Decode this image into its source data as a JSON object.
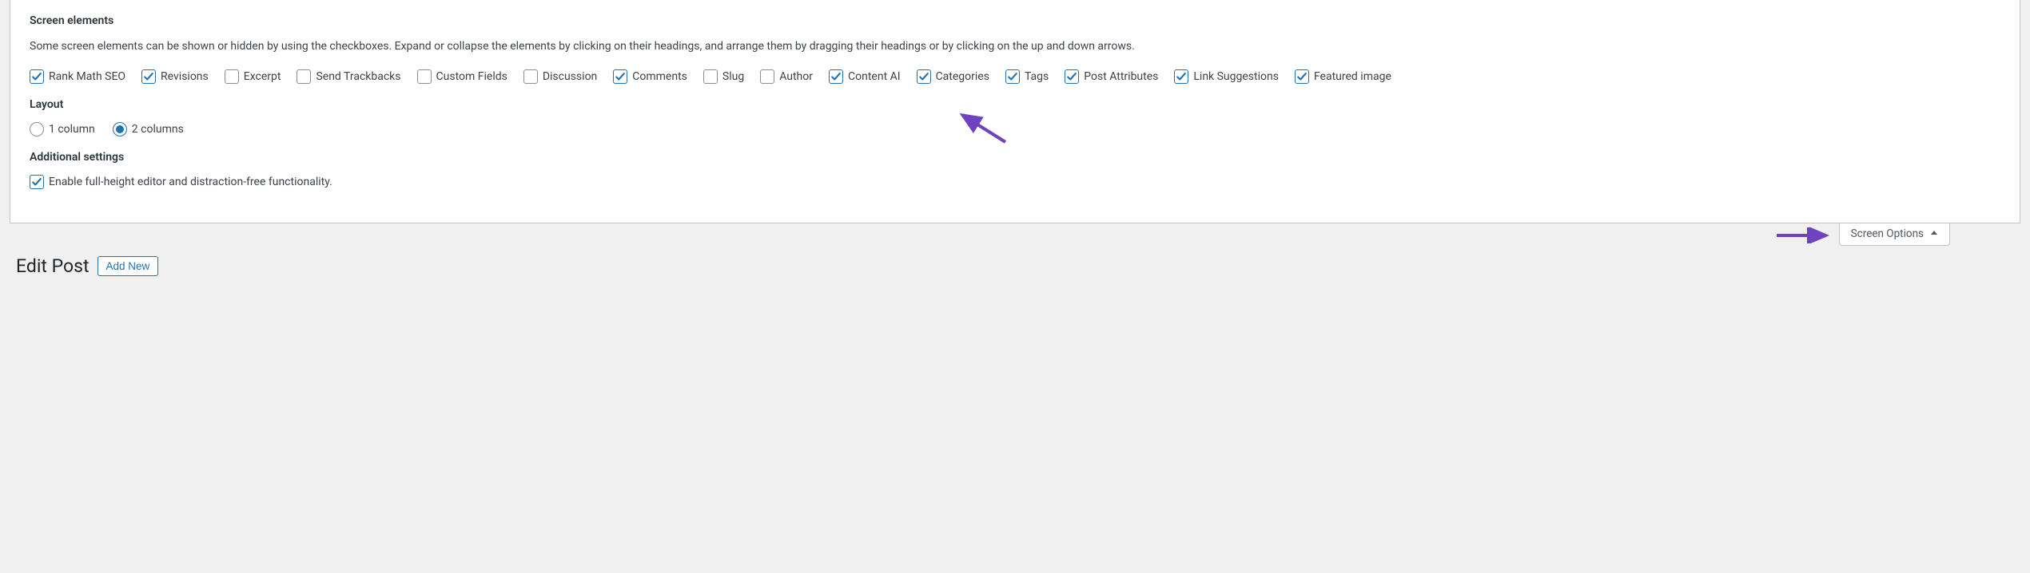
{
  "screen_options": {
    "elements": {
      "heading": "Screen elements",
      "description": "Some screen elements can be shown or hidden by using the checkboxes. Expand or collapse the elements by clicking on their headings, and arrange them by dragging their headings or by clicking on the up and down arrows.",
      "checkboxes": [
        {
          "label": "Rank Math SEO",
          "checked": true
        },
        {
          "label": "Revisions",
          "checked": true
        },
        {
          "label": "Excerpt",
          "checked": false
        },
        {
          "label": "Send Trackbacks",
          "checked": false
        },
        {
          "label": "Custom Fields",
          "checked": false
        },
        {
          "label": "Discussion",
          "checked": false
        },
        {
          "label": "Comments",
          "checked": true
        },
        {
          "label": "Slug",
          "checked": false
        },
        {
          "label": "Author",
          "checked": false
        },
        {
          "label": "Content AI",
          "checked": true
        },
        {
          "label": "Categories",
          "checked": true
        },
        {
          "label": "Tags",
          "checked": true
        },
        {
          "label": "Post Attributes",
          "checked": true
        },
        {
          "label": "Link Suggestions",
          "checked": true
        },
        {
          "label": "Featured image",
          "checked": true
        }
      ]
    },
    "layout": {
      "heading": "Layout",
      "options": [
        {
          "label": "1 column",
          "selected": false
        },
        {
          "label": "2 columns",
          "selected": true
        }
      ]
    },
    "additional": {
      "heading": "Additional settings",
      "checkbox": {
        "label": "Enable full-height editor and distraction-free functionality.",
        "checked": true
      }
    },
    "tab_label": "Screen Options"
  },
  "page": {
    "title": "Edit Post",
    "add_new_label": "Add New"
  },
  "annotation": {
    "color": "#6f42c1"
  }
}
